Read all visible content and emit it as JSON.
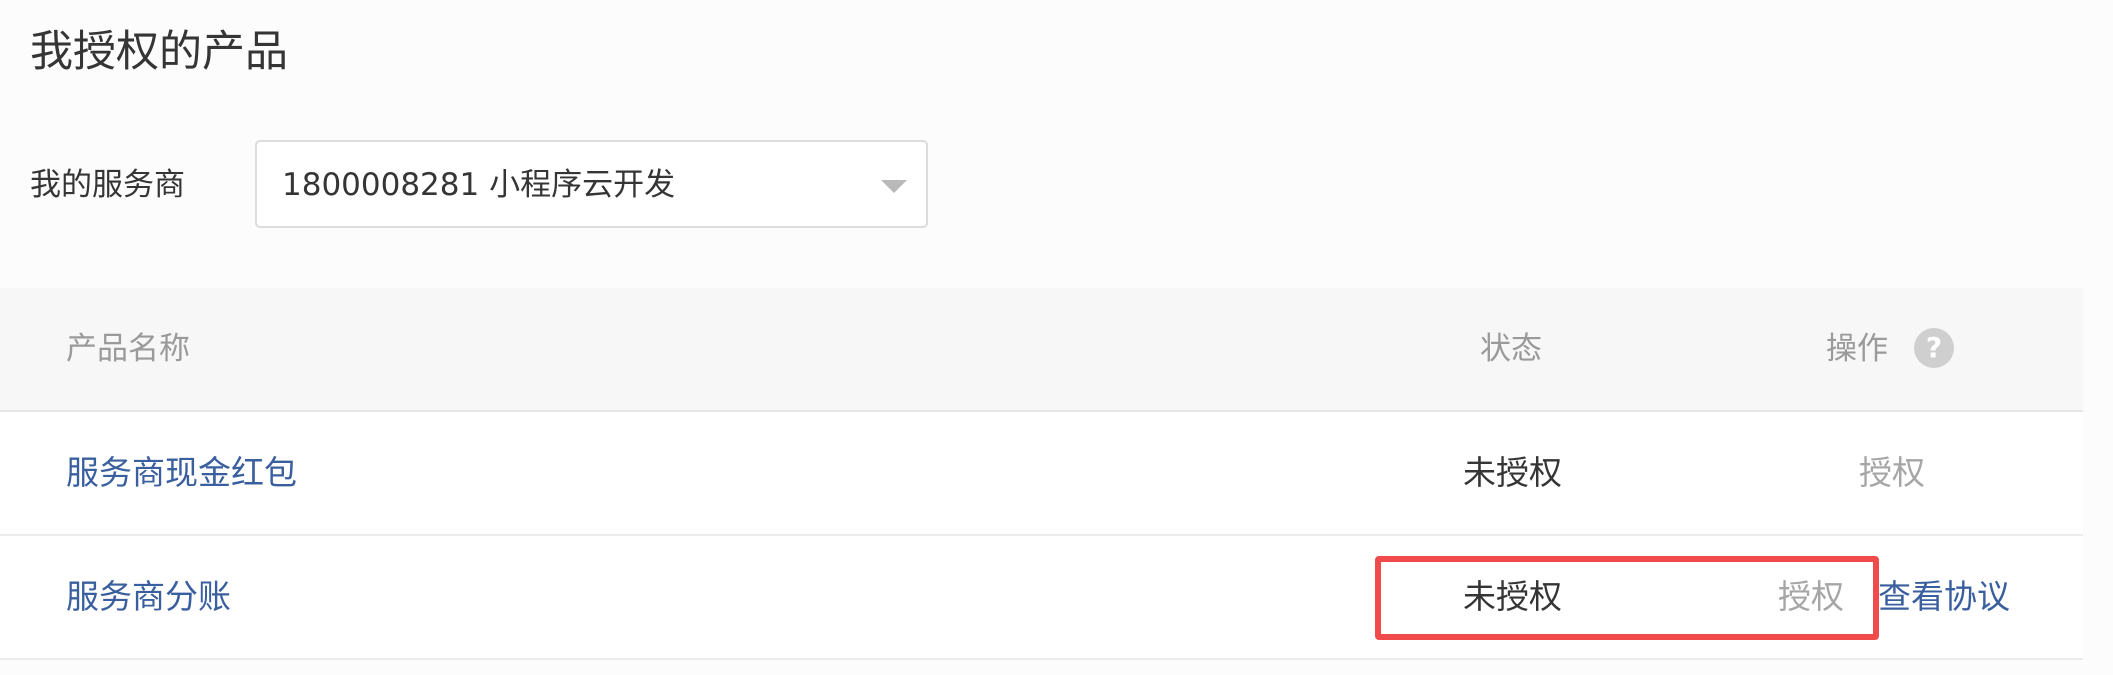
{
  "page": {
    "title": "我授权的产品"
  },
  "provider": {
    "label": "我的服务商",
    "selected": "1800008281 小程序云开发"
  },
  "table": {
    "headers": {
      "name": "产品名称",
      "status": "状态",
      "operations": "操作"
    },
    "help_icon": "question-circle-icon",
    "help_glyph": "?",
    "rows": [
      {
        "name": "服务商现金红包",
        "status": "未授权",
        "action": "授权"
      },
      {
        "name": "服务商分账",
        "status": "未授权",
        "action": "授权",
        "extra_action": "查看协议"
      }
    ]
  },
  "colors": {
    "link": "#3a5f9e",
    "muted_action": "#a6a6a6",
    "highlight": "#f04a4a",
    "header_bg": "#f7f7f7"
  }
}
